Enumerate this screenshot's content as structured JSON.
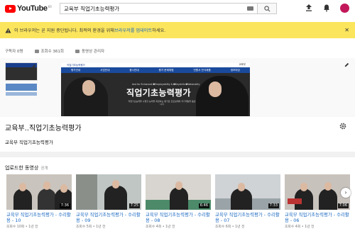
{
  "header": {
    "logo_text": "YouTube",
    "logo_region": "KR",
    "search_value": "교육부 직업기초능력평가"
  },
  "banner": {
    "text": "이 브라우저는 곧 지원 중단됩니다. 최적의 환경을 위해 ",
    "link": "브라우저를 업데이트",
    "text_end": "하세요."
  },
  "stats": {
    "subscribers": "구독자 0명",
    "views": "조회수 361회",
    "manage": "동영상 관리자"
  },
  "channel_art": {
    "brand": "직업기초능력평가",
    "gov": "교육부",
    "nav": [
      "평가안내",
      "사업안내",
      "응시안내",
      "평가 문제체험",
      "민원서 안식제품",
      "정보마당"
    ],
    "tag": "test for Enhanced ➊Employability & ➋Keyskills ➌Nationality",
    "title": "직업기초능력평가",
    "subtitle": "직업기초능력을 수행할 능력을 측정하는 평가로 진로설계와 자기개발을 돕습니다"
  },
  "channel": {
    "title": "교육부..직업기초능력평가",
    "playlist": "교육부 직업기초능력평가"
  },
  "uploads": {
    "label": "업로드한 동영상",
    "sub_label": "공개",
    "videos": [
      {
        "title": "교육부 직업기초능력평가 - 수리활용 - 10",
        "meta": "조회수 10회 • 1년 전",
        "duration": "7:36"
      },
      {
        "title": "교육부 직업기초능력평가 - 수리활용 - 09",
        "meta": "조회수 5회 • 1년 전",
        "duration": "7:25"
      },
      {
        "title": "교육부 직업기초능력평가 - 수리활용 - 08",
        "meta": "조회수 4회 • 1년 전",
        "duration": "6:46"
      },
      {
        "title": "교육부 직업기초능력평가 - 수리활용 - 07",
        "meta": "조회수 6회 • 1년 전",
        "duration": "7:33"
      },
      {
        "title": "교육부 직업기초능력평가 - 수리활용 - 06",
        "meta": "조회수 4회 • 1년 전",
        "duration": "7:06"
      }
    ]
  },
  "colors": {
    "brand_red": "#ff0000",
    "banner_yellow": "#fbe55d",
    "link_blue": "#1565c0",
    "art_blue": "#1a4a9c"
  }
}
